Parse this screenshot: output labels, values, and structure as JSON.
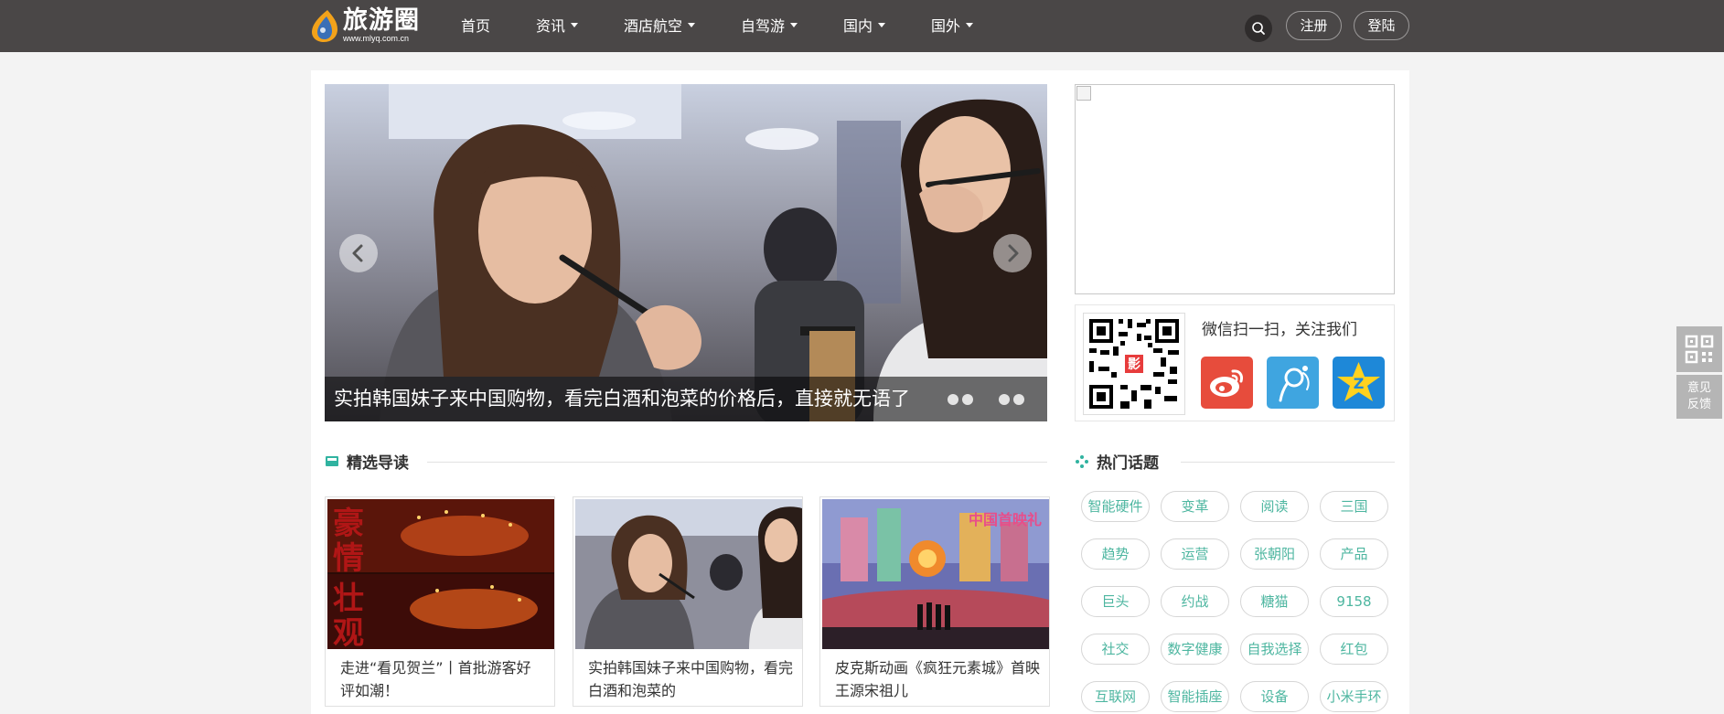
{
  "header": {
    "logo_text": "旅游圈",
    "logo_url": "www.mlyq.com.cn",
    "nav": [
      {
        "label": "首页"
      },
      {
        "label": "资讯"
      },
      {
        "label": "酒店航空"
      },
      {
        "label": "自驾游"
      },
      {
        "label": "国内"
      },
      {
        "label": "国外"
      }
    ],
    "register_label": "注册",
    "login_label": "登陆"
  },
  "slider": {
    "caption": "实拍韩国妹子来中国购物，看完白酒和泡菜的价格后，直接就无语了"
  },
  "follow": {
    "title": "微信扫一扫，关注我们"
  },
  "featured": {
    "title": "精选导读",
    "cards": [
      {
        "title": "走进“看见贺兰”丨首批游客好评如潮！"
      },
      {
        "title": "实拍韩国妹子来中国购物，看完白酒和泡菜的"
      },
      {
        "title": "皮克斯动画《疯狂元素城》首映 王源宋祖儿"
      }
    ]
  },
  "hot_topics": {
    "title": "热门话题",
    "tags": [
      "智能硬件",
      "变革",
      "阅读",
      "三国",
      "趋势",
      "运营",
      "张朝阳",
      "产品",
      "巨头",
      "约战",
      "糖猫",
      "9158",
      "社交",
      "数字健康",
      "自我选择",
      "红包",
      "互联网",
      "智能插座",
      "设备",
      "小米手环"
    ]
  },
  "floating": {
    "feedback_line1": "意见",
    "feedback_line2": "反馈"
  },
  "colors": {
    "topbar": "#4a4747",
    "tag_text": "#4db6a0",
    "page_bg": "#f3f3f3"
  }
}
